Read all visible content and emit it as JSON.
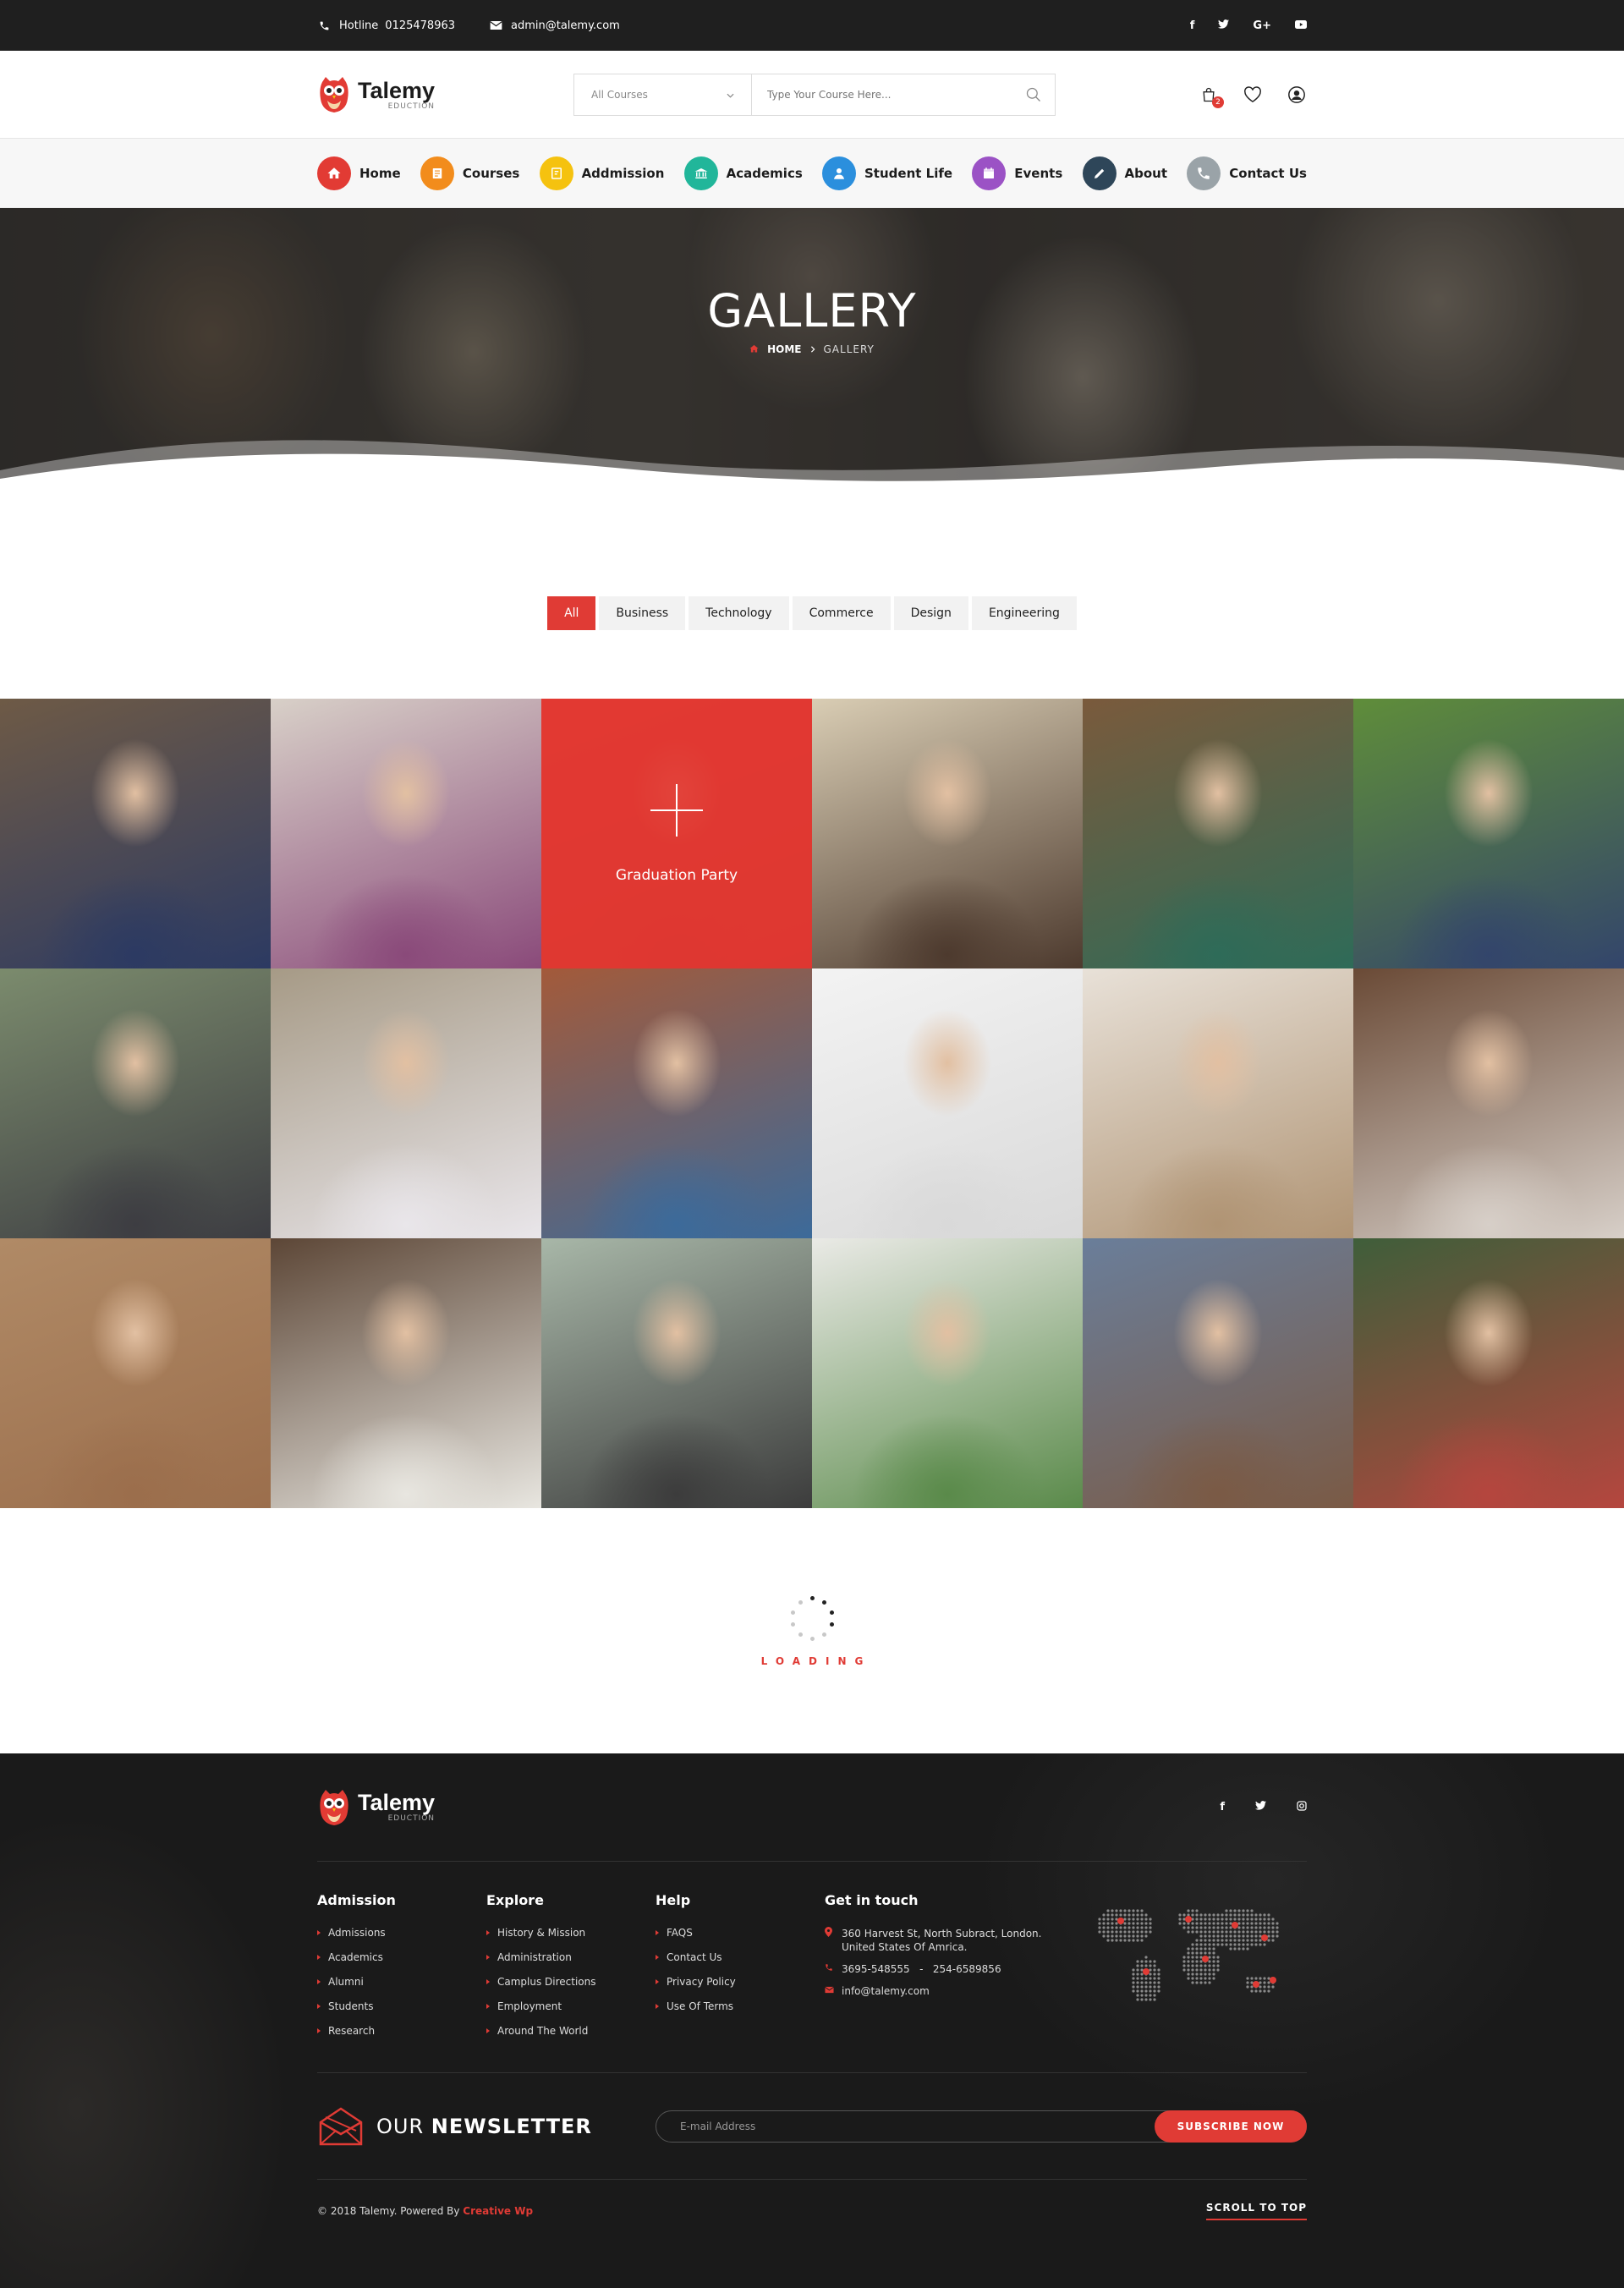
{
  "topbar": {
    "hotline_label": "Hotline",
    "hotline_number": "0125478963",
    "email": "admin@talemy.com",
    "socials": [
      "f",
      "t",
      "G+",
      "yt"
    ]
  },
  "brand": {
    "name": "Talemy",
    "tagline": "EDUCTION"
  },
  "search": {
    "category": "All Courses",
    "placeholder": "Type Your Course Here..."
  },
  "cart": {
    "count": "2"
  },
  "nav": [
    {
      "label": "Home",
      "color": "#e23b34",
      "icon": "home-icon"
    },
    {
      "label": "Courses",
      "color": "#f28c1c",
      "icon": "courses-icon"
    },
    {
      "label": "Addmission",
      "color": "#f5c20f",
      "icon": "addmission-icon"
    },
    {
      "label": "Academics",
      "color": "#21b69a",
      "icon": "academics-icon"
    },
    {
      "label": "Student Life",
      "color": "#2b8fdd",
      "icon": "student-icon"
    },
    {
      "label": "Events",
      "color": "#9b52c5",
      "icon": "events-icon"
    },
    {
      "label": "About",
      "color": "#2e4659",
      "icon": "about-icon"
    },
    {
      "label": "Contact Us",
      "color": "#9aa3a8",
      "icon": "phone-icon"
    }
  ],
  "hero": {
    "title": "GALLERY",
    "crumb_home": "HOME",
    "crumb_current": "GALLERY"
  },
  "filters": [
    "All",
    "Business",
    "Technology",
    "Commerce",
    "Design",
    "Engineering"
  ],
  "filter_active": "All",
  "gallery": {
    "hover_caption": "Graduation Party",
    "tiles": [
      {
        "bg1": "#6e5a46",
        "bg2": "#2c3a62"
      },
      {
        "bg1": "#d8d0c8",
        "bg2": "#8a4a7a"
      },
      {
        "bg1": "#e3403a",
        "bg2": "#b42e2a"
      },
      {
        "bg1": "#d9cdb4",
        "bg2": "#4d3a2e"
      },
      {
        "bg1": "#7a5a3c",
        "bg2": "#2e6b58"
      },
      {
        "bg1": "#5f8d3a",
        "bg2": "#33456b"
      },
      {
        "bg1": "#7b8b6d",
        "bg2": "#3d3d42"
      },
      {
        "bg1": "#a69a86",
        "bg2": "#e9e6ea"
      },
      {
        "bg1": "#a35a3a",
        "bg2": "#3c6a9a"
      },
      {
        "bg1": "#f3f3f3",
        "bg2": "#d9d9d9"
      },
      {
        "bg1": "#e8e1d8",
        "bg2": "#b09474"
      },
      {
        "bg1": "#6a4a36",
        "bg2": "#d7cfc8"
      },
      {
        "bg1": "#b08a66",
        "bg2": "#9b6e4c"
      },
      {
        "bg1": "#5c4636",
        "bg2": "#e8e6e0"
      },
      {
        "bg1": "#a8b7a8",
        "bg2": "#3c3c3c"
      },
      {
        "bg1": "#eaeae6",
        "bg2": "#5a8a4a"
      },
      {
        "bg1": "#6a7e9a",
        "bg2": "#7a5a45"
      },
      {
        "bg1": "#3f5e3a",
        "bg2": "#b5463e"
      }
    ]
  },
  "loading": {
    "text": "LOADING"
  },
  "footer": {
    "columns": [
      {
        "title": "Admission",
        "items": [
          "Admissions",
          "Academics",
          "Alumni",
          "Students",
          "Research"
        ]
      },
      {
        "title": "Explore",
        "items": [
          "History & Mission",
          "Administration",
          "Camplus Directions",
          "Employment",
          "Around The World"
        ]
      },
      {
        "title": "Help",
        "items": [
          "FAQS",
          "Contact Us",
          "Privacy Policy",
          "Use Of Terms"
        ]
      }
    ],
    "touch": {
      "title": "Get in touch",
      "address_line1": "360 Harvest St, North Subract, London.",
      "address_line2": "United States Of Amrica.",
      "phones": "3695-548555   -   254-6589856",
      "email": "info@talemy.com"
    },
    "newsletter": {
      "title_light": "OUR",
      "title_bold": "NEWSLETTER",
      "placeholder": "E-mail Address",
      "button": "SUBSCRIBE NOW"
    },
    "copyright": "© 2018 Talemy.  Powered By",
    "powered_by": "Creative Wp",
    "scroll_top": "SCROLL TO TOP",
    "socials": [
      "f",
      "t",
      "ig"
    ]
  },
  "colors": {
    "accent": "#e03b35",
    "dark": "#1f1f1f"
  }
}
